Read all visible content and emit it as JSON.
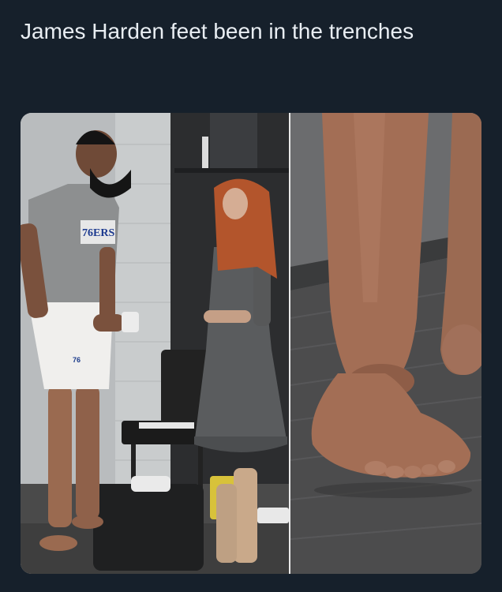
{
  "tweet": {
    "caption": "James Harden feet been in the trenches"
  },
  "media": {
    "jersey_text": "76ERS",
    "shorts_number": "76",
    "colors": {
      "background": "#16202b",
      "caption_text": "#e9eef3",
      "locker_wall": "#cfd2d4",
      "carpet": "#4a4a4a",
      "dress": "#5a5c5e",
      "skin": "#a06a4e"
    }
  }
}
